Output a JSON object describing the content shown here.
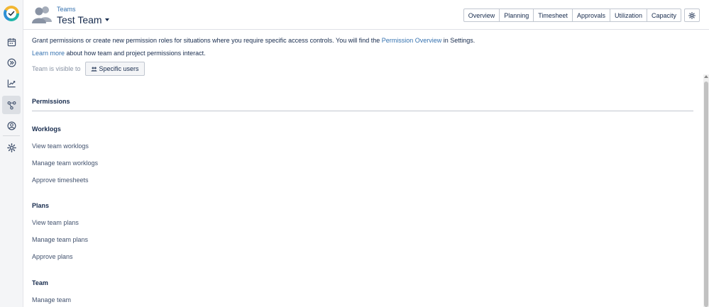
{
  "header": {
    "breadcrumb": "Teams",
    "title": "Test Team",
    "tabs": [
      "Overview",
      "Planning",
      "Timesheet",
      "Approvals",
      "Utilization",
      "Capacity"
    ]
  },
  "sidebar": {
    "items": [
      "calendar-icon",
      "double-chevron-right-icon",
      "chart-line-icon",
      "team-network-icon",
      "user-circle-icon",
      "gear-icon"
    ],
    "active": "team-network-icon"
  },
  "intro": {
    "text_before": "Grant permissions or create new permission roles for situations where you require specific access controls. You will find the ",
    "link": "Permission Overview",
    "text_after": " in Settings.",
    "learn_more": "Learn more",
    "learn_more_after": " about how team and project permissions interact."
  },
  "visibility": {
    "label": "Team is visible to",
    "button": "Specific users"
  },
  "permissions": {
    "title": "Permissions",
    "worklogs": {
      "title": "Worklogs",
      "items": [
        "View team worklogs",
        "Manage team worklogs",
        "Approve timesheets"
      ]
    },
    "plans": {
      "title": "Plans",
      "items": [
        "View team plans",
        "Manage team plans",
        "Approve plans"
      ]
    },
    "team": {
      "title": "Team",
      "items": [
        "Manage team"
      ]
    }
  },
  "colors": {
    "link": "#3572b0",
    "text": "#172b4d",
    "muted": "#8993a4"
  }
}
